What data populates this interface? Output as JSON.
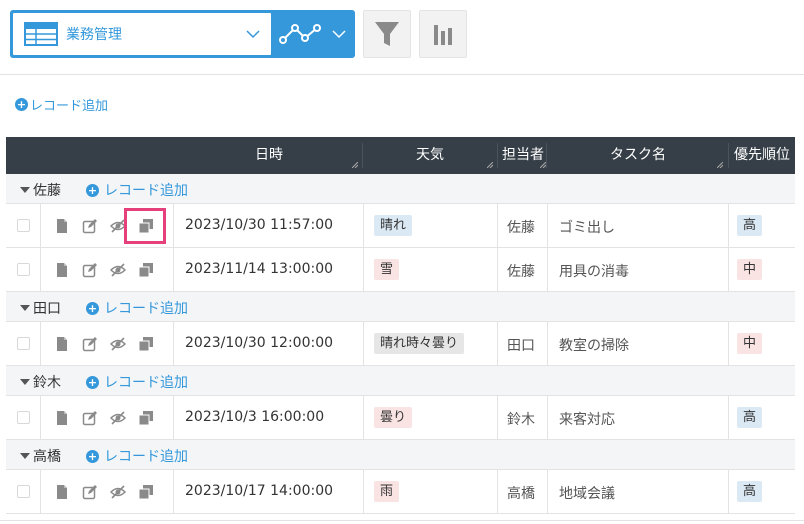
{
  "toolbar": {
    "view_name": "業務管理",
    "colors": {
      "accent": "#3498db",
      "header_bg": "#363f47",
      "highlight": "#e6407c"
    }
  },
  "add_record_label": "レコード追加",
  "columns": [
    "日時",
    "天気",
    "担当者",
    "タスク名",
    "優先順位"
  ],
  "groups": [
    {
      "name": "佐藤",
      "add_label": "レコード追加",
      "rows": [
        {
          "datetime": "2023/10/30 11:57:00",
          "weather": "晴れ",
          "weather_color": "#dbe9f4",
          "person": "佐藤",
          "task": "ゴミ出し",
          "priority": "高",
          "priority_color": "#dbe9f4"
        },
        {
          "datetime": "2023/11/14 13:00:00",
          "weather": "雪",
          "weather_color": "#f9e3e3",
          "person": "佐藤",
          "task": "用具の消毒",
          "priority": "中",
          "priority_color": "#f9e3e3"
        }
      ]
    },
    {
      "name": "田口",
      "add_label": "レコード追加",
      "rows": [
        {
          "datetime": "2023/10/30 12:00:00",
          "weather": "晴れ時々曇り",
          "weather_color": "#e6e6e6",
          "person": "田口",
          "task": "教室の掃除",
          "priority": "中",
          "priority_color": "#f9e3e3"
        }
      ]
    },
    {
      "name": "鈴木",
      "add_label": "レコード追加",
      "rows": [
        {
          "datetime": "2023/10/3 16:00:00",
          "weather": "曇り",
          "weather_color": "#f9e3e3",
          "person": "鈴木",
          "task": "来客対応",
          "priority": "高",
          "priority_color": "#dbe9f4"
        }
      ]
    },
    {
      "name": "高橋",
      "add_label": "レコード追加",
      "rows": [
        {
          "datetime": "2023/10/17 14:00:00",
          "weather": "雨",
          "weather_color": "#f9e3e3",
          "person": "高橋",
          "task": "地域会議",
          "priority": "高",
          "priority_color": "#dbe9f4"
        }
      ]
    }
  ]
}
